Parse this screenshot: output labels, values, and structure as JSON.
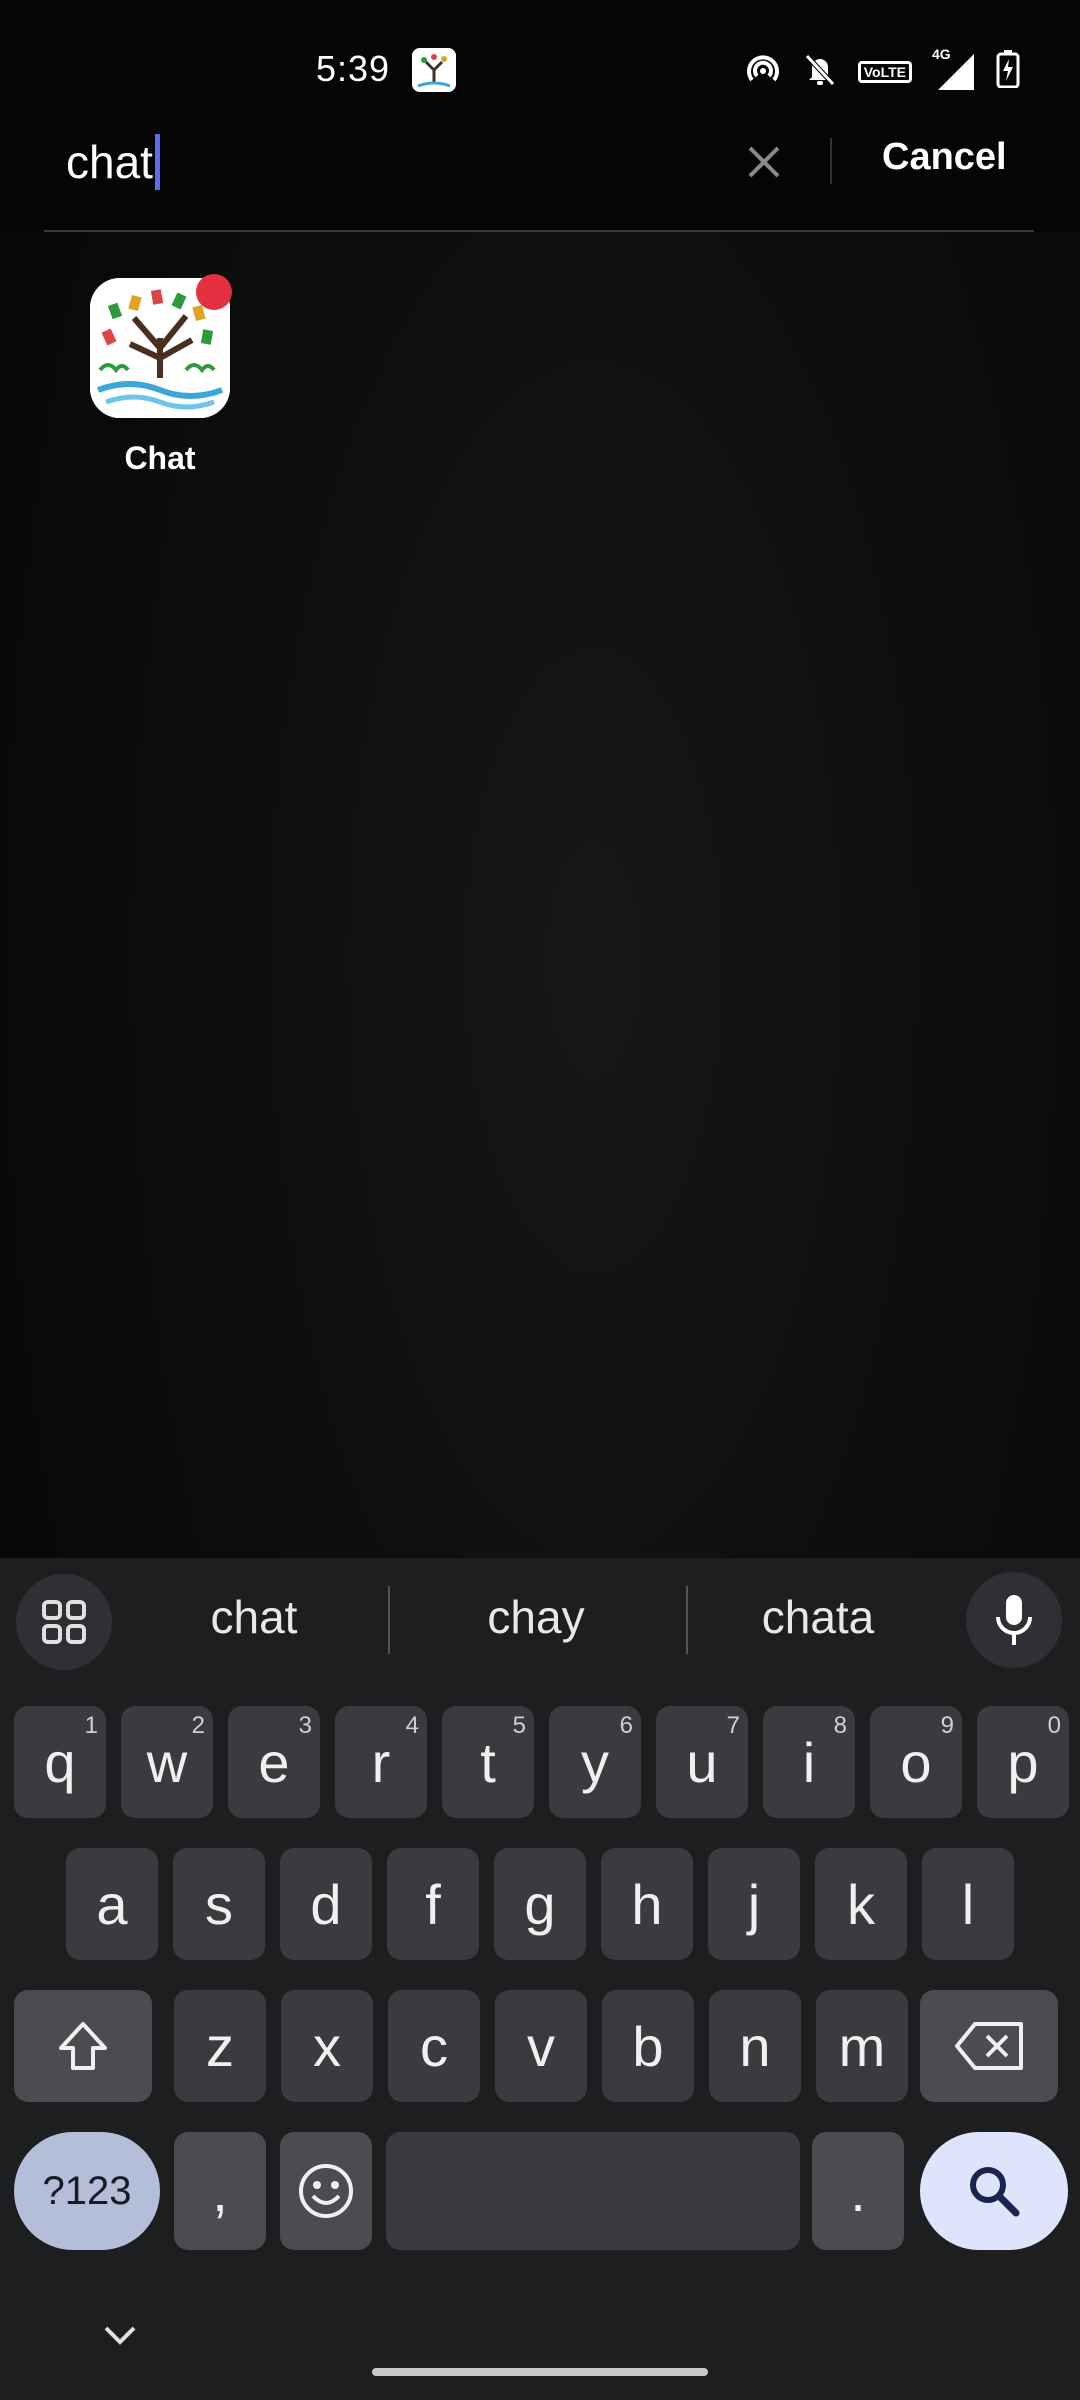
{
  "status_bar": {
    "time": "5:39",
    "network": "4G",
    "volte_label": "VoLTE"
  },
  "search": {
    "query": "chat",
    "cancel_label": "Cancel"
  },
  "results": [
    {
      "app_name": "Chat",
      "has_badge": true,
      "badge_color": "#e33142"
    }
  ],
  "keyboard": {
    "suggestions": [
      "chat",
      "chay",
      "chata"
    ],
    "row1": [
      {
        "k": "q",
        "n": "1"
      },
      {
        "k": "w",
        "n": "2"
      },
      {
        "k": "e",
        "n": "3"
      },
      {
        "k": "r",
        "n": "4"
      },
      {
        "k": "t",
        "n": "5"
      },
      {
        "k": "y",
        "n": "6"
      },
      {
        "k": "u",
        "n": "7"
      },
      {
        "k": "i",
        "n": "8"
      },
      {
        "k": "o",
        "n": "9"
      },
      {
        "k": "p",
        "n": "0"
      }
    ],
    "row2": [
      "a",
      "s",
      "d",
      "f",
      "g",
      "h",
      "j",
      "k",
      "l"
    ],
    "row3": [
      "z",
      "x",
      "c",
      "v",
      "b",
      "n",
      "m"
    ],
    "num_label": "?123",
    "comma": ",",
    "period": ".",
    "accent_color": "#dde4fb"
  }
}
